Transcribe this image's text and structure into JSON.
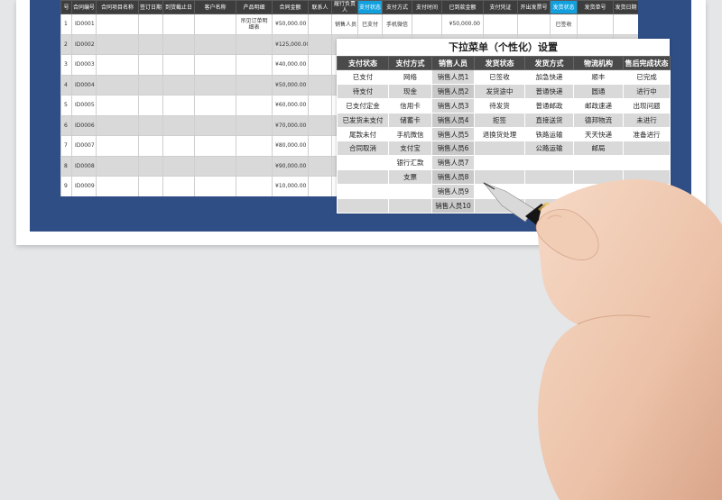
{
  "main_sheet": {
    "headers": [
      {
        "label": "号",
        "highlight": false
      },
      {
        "label": "合同编号",
        "highlight": false
      },
      {
        "label": "合同项目名称",
        "highlight": false
      },
      {
        "label": "签订日期",
        "highlight": false
      },
      {
        "label": "到货截止日",
        "highlight": false
      },
      {
        "label": "客户名称",
        "highlight": false
      },
      {
        "label": "产品明细",
        "highlight": false
      },
      {
        "label": "合同金额",
        "highlight": false
      },
      {
        "label": "联系人",
        "highlight": false
      },
      {
        "label": "履行负责人",
        "highlight": false
      },
      {
        "label": "支付状态",
        "highlight": true
      },
      {
        "label": "支付方式",
        "highlight": false
      },
      {
        "label": "支付时间",
        "highlight": false
      },
      {
        "label": "已到款金额",
        "highlight": false
      },
      {
        "label": "支付凭证",
        "highlight": false
      },
      {
        "label": "开出发票号",
        "highlight": false
      },
      {
        "label": "发货状态",
        "highlight": true
      },
      {
        "label": "发货单号",
        "highlight": false
      },
      {
        "label": "发货日期",
        "highlight": false
      }
    ],
    "rows": [
      {
        "no": "1",
        "id": "ID0001",
        "product": "吊见订单明细表",
        "amount": "¥50,000.00",
        "owner": "销售人员1",
        "pay_status": "已支付",
        "pay_method": "手机微信",
        "received": "¥50,000.00",
        "ship_status": "已签收"
      },
      {
        "no": "2",
        "id": "ID0002",
        "product": "",
        "amount": "¥125,000.00",
        "owner": "销售人",
        "pay_status": "",
        "pay_method": "",
        "received": "",
        "ship_status": ""
      },
      {
        "no": "3",
        "id": "ID0003",
        "product": "",
        "amount": "¥40,000.00",
        "owner": "",
        "pay_status": "",
        "pay_method": "",
        "received": "",
        "ship_status": ""
      },
      {
        "no": "4",
        "id": "ID0004",
        "product": "",
        "amount": "¥50,000.00",
        "owner": "",
        "pay_status": "",
        "pay_method": "",
        "received": "",
        "ship_status": ""
      },
      {
        "no": "5",
        "id": "ID0005",
        "product": "",
        "amount": "¥60,000.00",
        "owner": "",
        "pay_status": "",
        "pay_method": "",
        "received": "",
        "ship_status": ""
      },
      {
        "no": "6",
        "id": "ID0006",
        "product": "",
        "amount": "¥70,000.00",
        "owner": "",
        "pay_status": "",
        "pay_method": "",
        "received": "",
        "ship_status": ""
      },
      {
        "no": "7",
        "id": "ID0007",
        "product": "",
        "amount": "¥80,000.00",
        "owner": "",
        "pay_status": "",
        "pay_method": "",
        "received": "",
        "ship_status": ""
      },
      {
        "no": "8",
        "id": "ID0008",
        "product": "",
        "amount": "¥90,000.00",
        "owner": "",
        "pay_status": "",
        "pay_method": "",
        "received": "",
        "ship_status": ""
      },
      {
        "no": "9",
        "id": "ID0009",
        "product": "",
        "amount": "¥10,000.00",
        "owner": "",
        "pay_status": "",
        "pay_method": "",
        "received": "",
        "ship_status": ""
      }
    ]
  },
  "dropdown_card": {
    "title": "下拉菜单（个性化）设置",
    "headers": [
      "支付状态",
      "支付方式",
      "销售人员",
      "发货状态",
      "发货方式",
      "物流机构",
      "售后完成状态"
    ],
    "rows": [
      [
        "已支付",
        "网络",
        "销售人员1",
        "已签收",
        "加急快递",
        "顺丰",
        "已完成"
      ],
      [
        "待支付",
        "现金",
        "销售人员2",
        "发货途中",
        "普通快递",
        "圆通",
        "进行中"
      ],
      [
        "已支付定金",
        "信用卡",
        "销售人员3",
        "待发货",
        "普通邮政",
        "邮政速递",
        "出现问题"
      ],
      [
        "已发货未支付",
        "储蓄卡",
        "销售人员4",
        "拒签",
        "直接送货",
        "德邦物流",
        "未进行"
      ],
      [
        "尾款未付",
        "手机微信",
        "销售人员5",
        "退换货处理",
        "铁路运输",
        "天天快递",
        "准备进行"
      ],
      [
        "合同取消",
        "支付宝",
        "销售人员6",
        "",
        "公路运输",
        "邮局",
        ""
      ],
      [
        "",
        "银行汇款",
        "销售人员7",
        "",
        "",
        "",
        ""
      ],
      [
        "",
        "支票",
        "销售人员8",
        "",
        "",
        "",
        ""
      ],
      [
        "",
        "",
        "销售人员9",
        "",
        "",
        "",
        ""
      ],
      [
        "",
        "",
        "销售人员10",
        "",
        "",
        "",
        ""
      ]
    ]
  },
  "colors": {
    "frame_blue": "#2f4e86",
    "header_dark": "#3d3d3d",
    "header_highlight": "#11a0dd"
  }
}
